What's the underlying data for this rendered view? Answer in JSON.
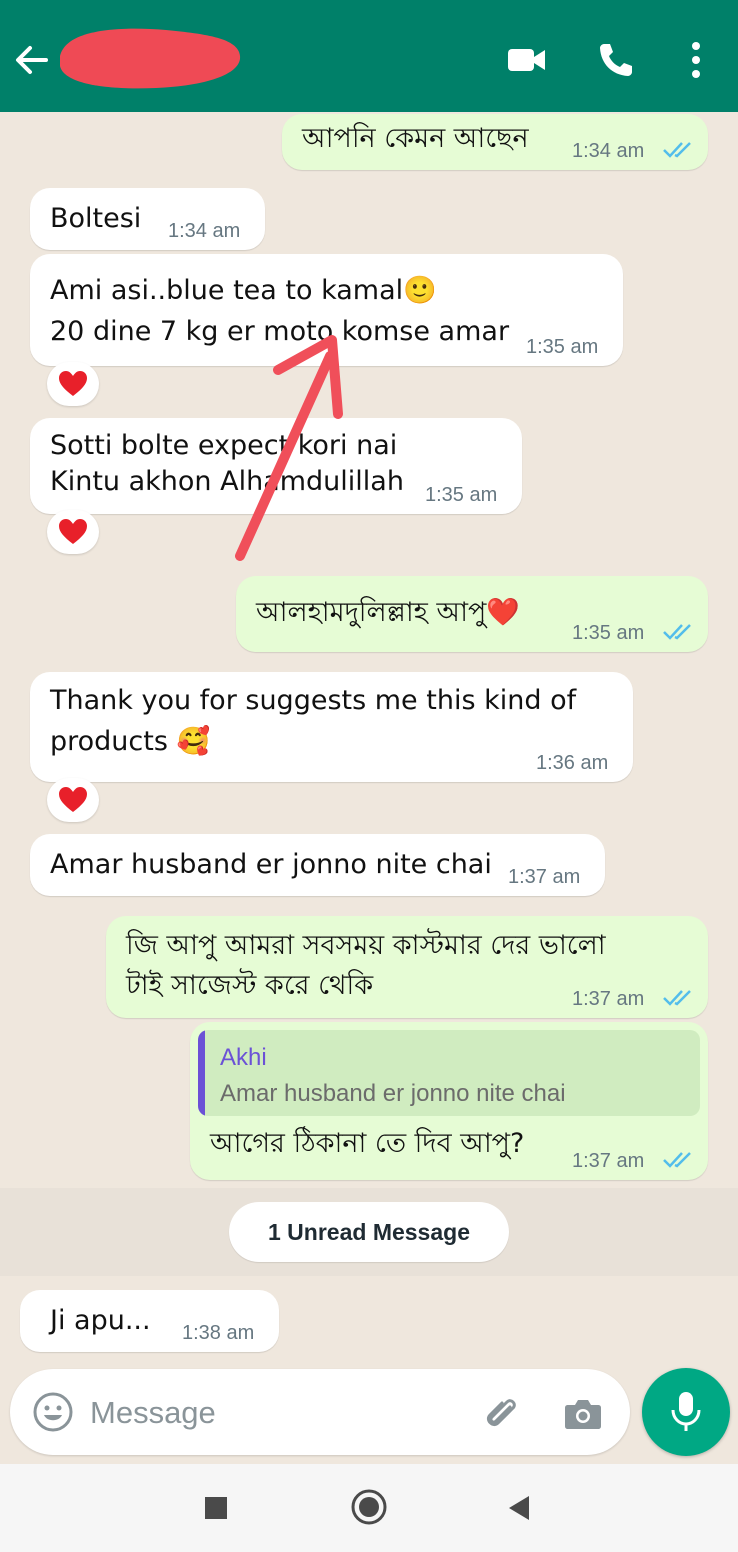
{
  "header": {
    "contact_name": "",
    "icons": [
      "back-arrow-icon",
      "video-call-icon",
      "voice-call-icon",
      "more-options-icon"
    ],
    "color": "#008069"
  },
  "messages": [
    {
      "id": 1,
      "direction": "out",
      "text": "আপনি কেমন আছেন",
      "time": "1:34 am",
      "status": "read"
    },
    {
      "id": 2,
      "direction": "in",
      "text": "Boltesi",
      "time": "1:34 am"
    },
    {
      "id": 3,
      "direction": "in",
      "text": "Ami asi..blue tea to kamal🙂\n20 dine 7 kg er moto komse amar",
      "time": "1:35 am",
      "reaction": "red-heart"
    },
    {
      "id": 4,
      "direction": "in",
      "text": "Sotti bolte expect kori nai\nKintu akhon Alhamdulillah",
      "time": "1:35 am",
      "reaction": "red-heart"
    },
    {
      "id": 5,
      "direction": "out",
      "text": "আলহামদুলিল্লাহ আপু❤️",
      "time": "1:35 am",
      "status": "read"
    },
    {
      "id": 6,
      "direction": "in",
      "text": "Thank you for suggests me this kind of\nproducts 🥰",
      "time": "1:36 am",
      "reaction": "red-heart"
    },
    {
      "id": 7,
      "direction": "in",
      "text": "Amar husband er jonno nite chai",
      "time": "1:37 am"
    },
    {
      "id": 8,
      "direction": "out",
      "text": "জি আপু আমরা সবসময় কাস্টমার দের ভালো\nটাই সাজেস্ট করে থেকি",
      "time": "1:37 am",
      "status": "read"
    },
    {
      "id": 9,
      "direction": "out",
      "quote": {
        "author": "Akhi",
        "text": "Amar husband er jonno nite chai"
      },
      "text": "আগের ঠিকানা তে দিব আপু?",
      "time": "1:37 am",
      "status": "read"
    },
    {
      "id": 10,
      "direction": "in",
      "text": "Ji apu...",
      "time": "1:38 am"
    }
  ],
  "unread_banner": "1 Unread Message",
  "composer": {
    "placeholder": "Message",
    "icons": [
      "emoji-icon",
      "attach-icon",
      "camera-icon",
      "mic-icon"
    ]
  },
  "colors": {
    "incoming": "#ffffff",
    "outgoing": "#e6fcd5",
    "chat_background": "#efe7dd",
    "read_ticks": "#53bdeb",
    "annotation_arrow": "#f04f5a",
    "reaction_heart": "#e8202a"
  },
  "annotation": {
    "type": "arrow",
    "color": "#f04f5a"
  }
}
